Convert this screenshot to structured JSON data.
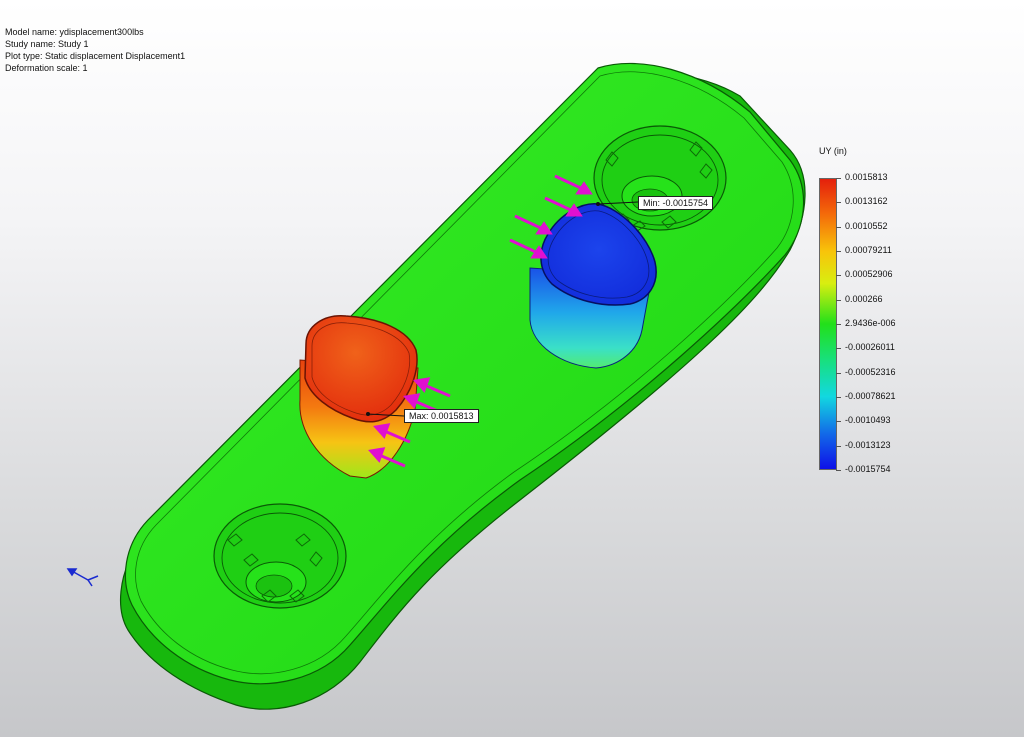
{
  "info": {
    "model_name": "Model name: ydisplacement300lbs",
    "study_name": "Study name: Study 1",
    "plot_type": "Plot type: Static displacement Displacement1",
    "deformation_scale": "Deformation scale: 1"
  },
  "legend": {
    "title": "UY (in)",
    "labels": [
      "0.0015813",
      "0.0013162",
      "0.0010552",
      "0.00079211",
      "0.00052906",
      "0.000266",
      "2.9436e-006",
      "-0.00026011",
      "-0.00052316",
      "-0.00078621",
      "-0.0010493",
      "-0.0013123",
      "-0.0015754"
    ]
  },
  "probes": {
    "max": "Max: 0.0015813",
    "min": "Min: -0.0015754"
  },
  "icons": [
    "triad-icon",
    "load-arrow-icon",
    "fixture-icon"
  ],
  "colors": {
    "part_green": "#22e01a",
    "max_red": "#e8230d",
    "min_blue": "#1030e8",
    "load_arrow": "#e010d0"
  }
}
